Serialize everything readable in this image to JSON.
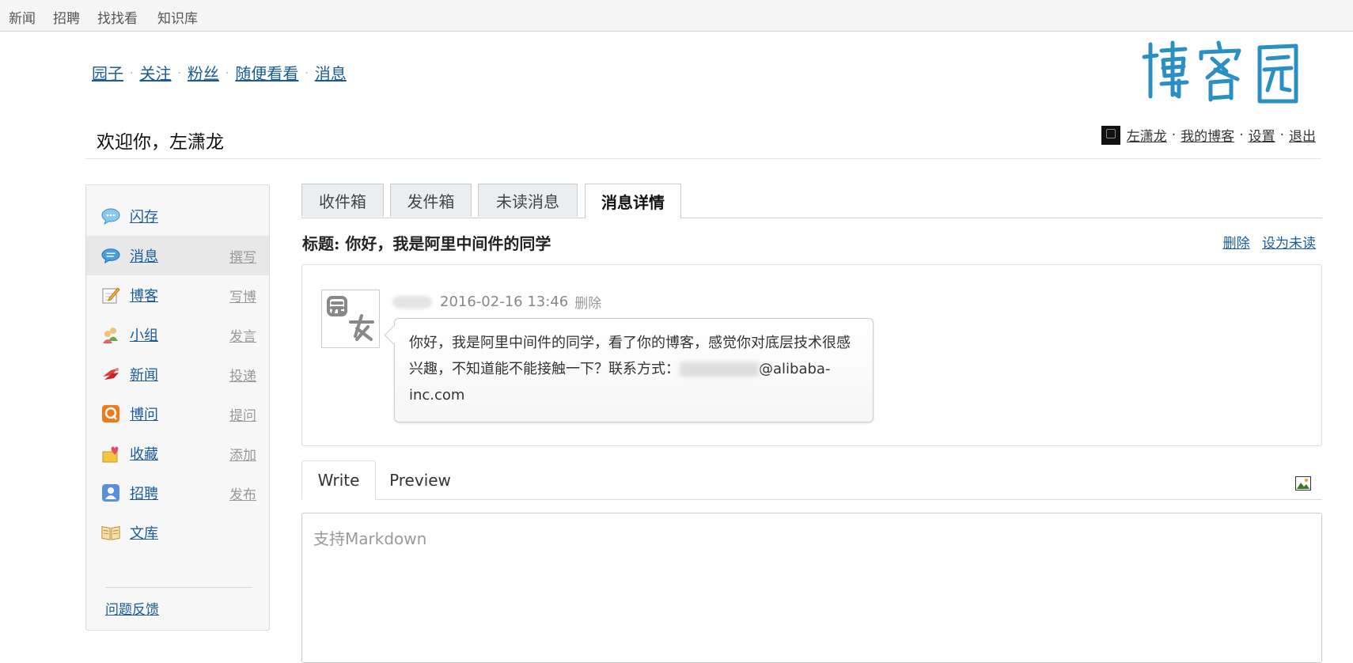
{
  "topbar": {
    "items": [
      "新闻",
      "招聘",
      "找找看",
      "知识库"
    ]
  },
  "nav": {
    "items": [
      "园子",
      "关注",
      "粉丝",
      "随便看看",
      "消息"
    ]
  },
  "welcome": "欢迎你，左潇龙",
  "userbar": {
    "username": "左潇龙",
    "my_blog": "我的博客",
    "settings": "设置",
    "logout": "退出"
  },
  "sidebar": {
    "items": [
      {
        "label": "闪存",
        "action": "",
        "icon": "speech-bubble-icon"
      },
      {
        "label": "消息",
        "action": "撰写",
        "icon": "message-icon"
      },
      {
        "label": "博客",
        "action": "写博",
        "icon": "pencil-note-icon"
      },
      {
        "label": "小组",
        "action": "发言",
        "icon": "group-icon"
      },
      {
        "label": "新闻",
        "action": "投递",
        "icon": "news-icon"
      },
      {
        "label": "博问",
        "action": "提问",
        "icon": "question-icon"
      },
      {
        "label": "收藏",
        "action": "添加",
        "icon": "favorite-icon"
      },
      {
        "label": "招聘",
        "action": "发布",
        "icon": "person-card-icon"
      },
      {
        "label": "文库",
        "action": "",
        "icon": "book-icon"
      }
    ],
    "feedback": "问题反馈"
  },
  "tabs": [
    "收件箱",
    "发件箱",
    "未读消息",
    "消息详情"
  ],
  "message": {
    "subject_label": "标题:",
    "subject": "你好，我是阿里中间件的同学",
    "delete": "删除",
    "mark_unread": "设为未读",
    "datetime": "2016-02-16 13:46",
    "item_delete": "删除",
    "body_part1": "你好，我是阿里中间件的同学，看了你的博客，感觉你对底层技术很感兴趣，不知道能不能接触一下？联系方式：",
    "body_part2": "@alibaba-inc.com"
  },
  "editor": {
    "write_tab": "Write",
    "preview_tab": "Preview",
    "placeholder": "支持Markdown"
  },
  "colors": {
    "link": "#1a5c9a",
    "logo": "#2b8fc4"
  }
}
